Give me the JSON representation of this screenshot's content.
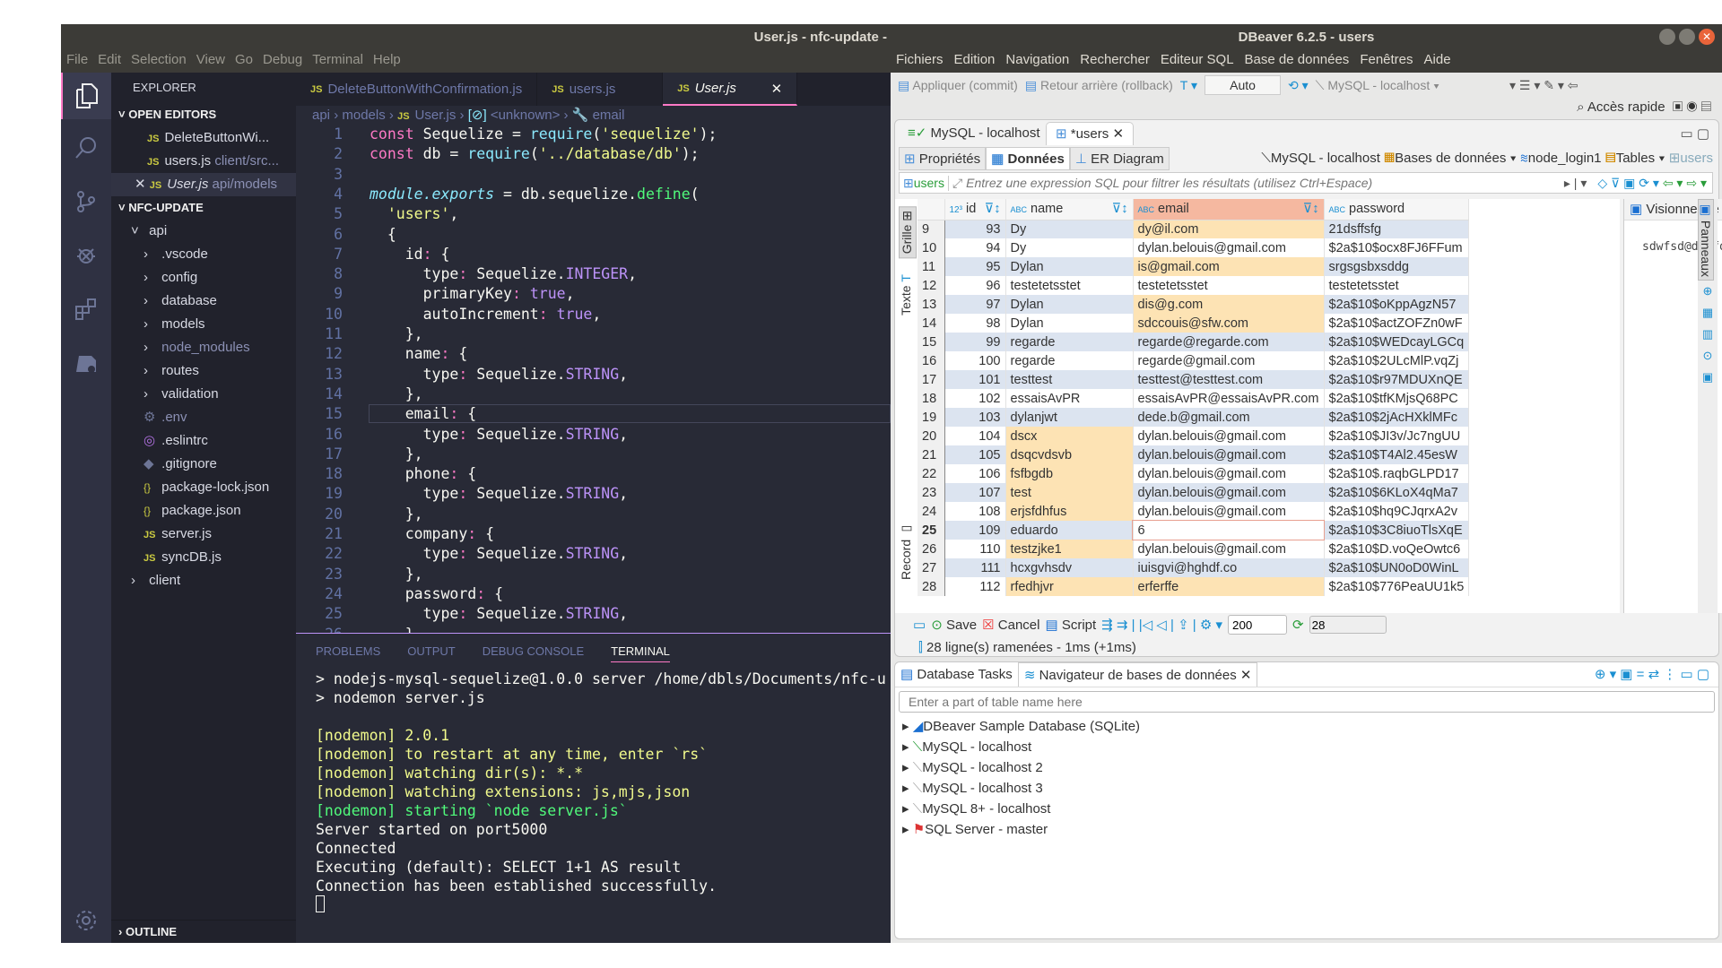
{
  "vscode": {
    "window_title": "User.js - nfc-update -",
    "menu": [
      "File",
      "Edit",
      "Selection",
      "View",
      "Go",
      "Debug",
      "Terminal",
      "Help"
    ],
    "sidebar": {
      "title": "EXPLORER",
      "open_editors_label": "OPEN EDITORS",
      "open_editors": [
        {
          "name": "DeleteButtonWi...",
          "path": ""
        },
        {
          "name": "users.js",
          "path": "client/src..."
        },
        {
          "name": "User.js",
          "path": "api/models"
        }
      ],
      "project_label": "NFC-UPDATE",
      "tree": [
        {
          "name": "api",
          "type": "folder-open",
          "depth": 1
        },
        {
          "name": ".vscode",
          "type": "folder",
          "depth": 2
        },
        {
          "name": "config",
          "type": "folder",
          "depth": 2
        },
        {
          "name": "database",
          "type": "folder",
          "depth": 2
        },
        {
          "name": "models",
          "type": "folder",
          "depth": 2
        },
        {
          "name": "node_modules",
          "type": "folder-dim",
          "depth": 2
        },
        {
          "name": "routes",
          "type": "folder",
          "depth": 2
        },
        {
          "name": "validation",
          "type": "folder",
          "depth": 2
        },
        {
          "name": ".env",
          "type": "gear",
          "depth": 2
        },
        {
          "name": ".eslintrc",
          "type": "eslint",
          "depth": 2
        },
        {
          "name": ".gitignore",
          "type": "git",
          "depth": 2
        },
        {
          "name": "package-lock.json",
          "type": "json",
          "depth": 2
        },
        {
          "name": "package.json",
          "type": "json",
          "depth": 2
        },
        {
          "name": "server.js",
          "type": "js",
          "depth": 2
        },
        {
          "name": "syncDB.js",
          "type": "js",
          "depth": 2
        },
        {
          "name": "client",
          "type": "folder",
          "depth": 1
        }
      ],
      "outline_label": "OUTLINE"
    },
    "tabs": [
      {
        "label": "DeleteButtonWithConfirmation.js",
        "active": false
      },
      {
        "label": "users.js",
        "active": false
      },
      {
        "label": "User.js",
        "active": true
      }
    ],
    "breadcrumb": [
      "api",
      "models",
      "User.js",
      "<unknown>",
      "email"
    ],
    "code_lines": [
      "const Sequelize = require('sequelize');",
      "const db = require('../database/db');",
      "",
      "module.exports = db.sequelize.define(",
      "  'users',",
      "  {",
      "    id: {",
      "      type: Sequelize.INTEGER,",
      "      primaryKey: true,",
      "      autoIncrement: true,",
      "    },",
      "    name: {",
      "      type: Sequelize.STRING,",
      "    },",
      "    email: {",
      "      type: Sequelize.STRING,",
      "    },",
      "    phone: {",
      "      type: Sequelize.STRING,",
      "    },",
      "    company: {",
      "      type: Sequelize.STRING,",
      "    },",
      "    password: {",
      "      type: Sequelize.STRING,",
      "    },"
    ],
    "panel_tabs": [
      "PROBLEMS",
      "OUTPUT",
      "DEBUG CONSOLE",
      "TERMINAL"
    ],
    "terminal_lines": [
      {
        "text": "> nodejs-mysql-sequelize@1.0.0 server /home/dbls/Documents/nfc-u",
        "color": "white"
      },
      {
        "text": "> nodemon server.js",
        "color": "white"
      },
      {
        "text": "",
        "color": "white"
      },
      {
        "text": "[nodemon] 2.0.1",
        "color": "yellow"
      },
      {
        "text": "[nodemon] to restart at any time, enter `rs`",
        "color": "yellow"
      },
      {
        "text": "[nodemon] watching dir(s): *.*",
        "color": "yellow"
      },
      {
        "text": "[nodemon] watching extensions: js,mjs,json",
        "color": "yellow"
      },
      {
        "text": "[nodemon] starting `node server.js`",
        "color": "green"
      },
      {
        "text": "Server started on port5000",
        "color": "white"
      },
      {
        "text": "Connected",
        "color": "white"
      },
      {
        "text": "Executing (default): SELECT 1+1 AS result",
        "color": "white"
      },
      {
        "text": "Connection has been established successfully.",
        "color": "white"
      }
    ]
  },
  "dbeaver": {
    "window_title": "DBeaver 6.2.5 - users",
    "menu": [
      "Fichiers",
      "Edition",
      "Navigation",
      "Rechercher",
      "Editeur SQL",
      "Base de données",
      "Fenêtres",
      "Aide"
    ],
    "toolbar": {
      "commit": "Appliquer (commit)",
      "rollback": "Retour arrière (rollback)",
      "tx_mode": "Auto",
      "connection": "MySQL - localhost",
      "quick_access": "Accès rapide"
    },
    "editor_tabs": [
      {
        "label": "MySQL - localhost",
        "active": false
      },
      {
        "label": "*users",
        "active": true
      }
    ],
    "sub_tabs": [
      "Propriétés",
      "Données",
      "ER Diagram"
    ],
    "active_sub_tab": "Données",
    "nav_path": [
      "MySQL - localhost",
      "Bases de données",
      "node_login1",
      "Tables",
      "users"
    ],
    "filter": {
      "table": "users",
      "placeholder": "Entrez une expression SQL pour filtrer les résultats (utilisez Ctrl+Espace)"
    },
    "side_tabs": {
      "grid": "Grille",
      "text": "Texte",
      "record": "Record"
    },
    "columns": [
      "id",
      "name",
      "email",
      "password"
    ],
    "rows": [
      {
        "n": "9",
        "id": "93",
        "name": "Dy",
        "email": "dy@il.com",
        "password": "21dsffsfg",
        "mod": [
          "email"
        ]
      },
      {
        "n": "10",
        "id": "94",
        "name": "Dy",
        "email": "dylan.belouis@gmail.com",
        "password": "$2a$10$ocx8FJ6FFum",
        "mod": []
      },
      {
        "n": "11",
        "id": "95",
        "name": "Dylan",
        "email": "is@gmail.com",
        "password": "srgsgsbxsddg",
        "mod": [
          "email"
        ]
      },
      {
        "n": "12",
        "id": "96",
        "name": "testetetsstet",
        "email": "testetetsstet",
        "password": "testetetsstet",
        "mod": []
      },
      {
        "n": "13",
        "id": "97",
        "name": "Dylan",
        "email": "dis@g.com",
        "password": "$2a$10$oKppAgzN57",
        "mod": [
          "email"
        ]
      },
      {
        "n": "14",
        "id": "98",
        "name": "Dylan",
        "email": "sdccouis@sfw.com",
        "password": "$2a$10$actZOFZn0wF",
        "mod": [
          "email"
        ]
      },
      {
        "n": "15",
        "id": "99",
        "name": "regarde",
        "email": "regarde@regarde.com",
        "password": "$2a$10$WEDcayLGCq",
        "mod": []
      },
      {
        "n": "16",
        "id": "100",
        "name": "regarde",
        "email": "regarde@gmail.com",
        "password": "$2a$10$2ULcMlP.vqZj",
        "mod": []
      },
      {
        "n": "17",
        "id": "101",
        "name": "testtest",
        "email": "testtest@testtest.com",
        "password": "$2a$10$r97MDUXnQE",
        "mod": []
      },
      {
        "n": "18",
        "id": "102",
        "name": "essaisAvPR",
        "email": "essaisAvPR@essaisAvPR.com",
        "password": "$2a$10$tfKMjsQ68PC",
        "mod": []
      },
      {
        "n": "19",
        "id": "103",
        "name": "dylanjwt",
        "email": "dede.b@gmail.com",
        "password": "$2a$10$2jAcHXklMFc",
        "mod": []
      },
      {
        "n": "20",
        "id": "104",
        "name": "dscx",
        "email": "dylan.belouis@gmail.com",
        "password": "$2a$10$JI3v/Jc7ngUU",
        "mod": [
          "name"
        ]
      },
      {
        "n": "21",
        "id": "105",
        "name": "dsqcvdsvb",
        "email": "dylan.belouis@gmail.com",
        "password": "$2a$10$T4Al2.45esW",
        "mod": [
          "name"
        ]
      },
      {
        "n": "22",
        "id": "106",
        "name": "fsfbgdb",
        "email": "dylan.belouis@gmail.com",
        "password": "$2a$10$.raqbGLPD17",
        "mod": [
          "name"
        ]
      },
      {
        "n": "23",
        "id": "107",
        "name": "test",
        "email": "dylan.belouis@gmail.com",
        "password": "$2a$10$6KLoX4qMa7",
        "mod": [
          "name"
        ]
      },
      {
        "n": "24",
        "id": "108",
        "name": "erjsfdhfus",
        "email": "dylan.belouis@gmail.com",
        "password": "$2a$10$hq9CJqrxA2v",
        "mod": [
          "name"
        ]
      },
      {
        "n": "25",
        "id": "109",
        "name": "eduardo",
        "email": "6",
        "password": "$2a$10$3C8iuoTlsXqE",
        "mod": [],
        "editing": true
      },
      {
        "n": "26",
        "id": "110",
        "name": "testzjke1",
        "email": "dylan.belouis@gmail.com",
        "password": "$2a$10$D.voQeOwtc6",
        "mod": [
          "name"
        ]
      },
      {
        "n": "27",
        "id": "111",
        "name": "hcxgvhsdv",
        "email": "iuisgvi@hghdf.co",
        "password": "$2a$10$UN0oD0WinL",
        "mod": []
      },
      {
        "n": "28",
        "id": "112",
        "name": "rfedhjvr",
        "email": "erferffe",
        "password": "$2a$10$776PeaUU1k5",
        "mod": [
          "name",
          "email"
        ]
      }
    ],
    "value_viewer": {
      "title": "Visionneuse de valeurs",
      "value": "sdwfsd@dsffds.com"
    },
    "panels_label": "Panneaux",
    "bottom_bar": {
      "save": "Save",
      "cancel": "Cancel",
      "script": "Script",
      "fetch_size": "200",
      "row_count": "28"
    },
    "status": "28 ligne(s) ramenées - 1ms (+1ms)",
    "nav_tabs": [
      {
        "label": "Database Tasks",
        "active": false
      },
      {
        "label": "Navigateur de bases de données",
        "active": true
      }
    ],
    "nav_search_placeholder": "Enter a part of table name here",
    "connections": [
      "DBeaver Sample Database (SQLite)",
      "MySQL - localhost",
      "MySQL - localhost 2",
      "MySQL - localhost 3",
      "MySQL 8+ - localhost",
      "SQL Server - master"
    ]
  }
}
